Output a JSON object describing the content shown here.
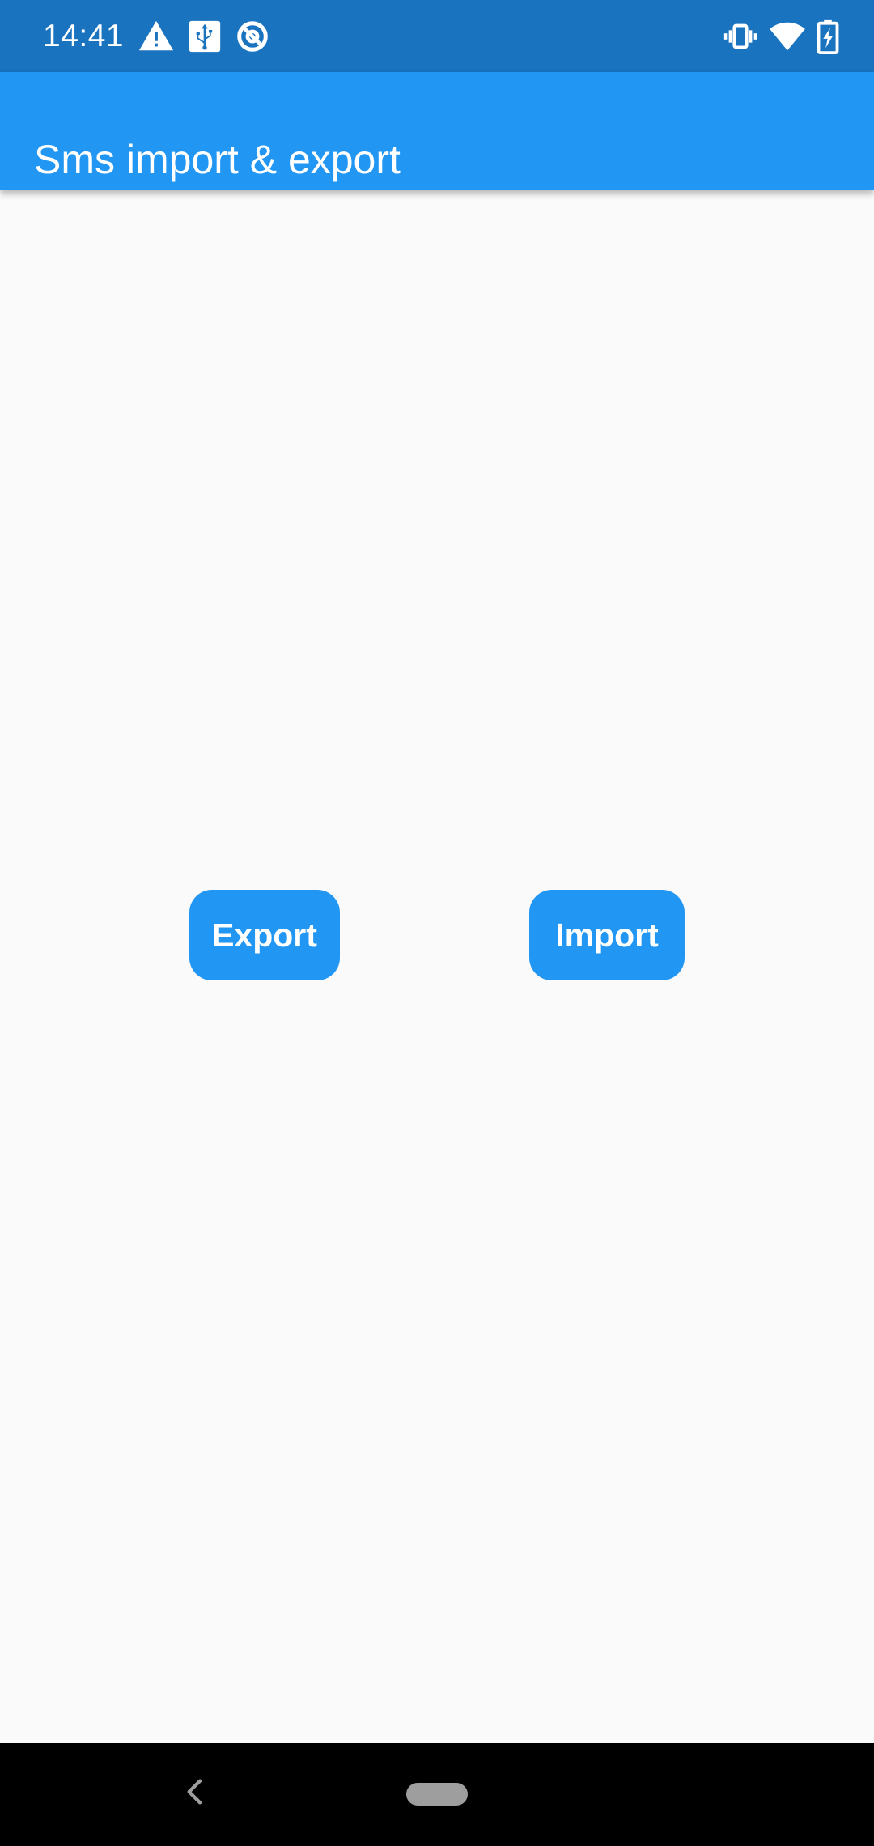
{
  "status_bar": {
    "time": "14:41",
    "icons_left": [
      "warning-icon",
      "usb-icon",
      "sync-disabled-icon"
    ],
    "icons_right": [
      "vibrate-icon",
      "wifi-icon",
      "battery-charging-icon"
    ]
  },
  "app_bar": {
    "title": "Sms import & export"
  },
  "main": {
    "export_label": "Export",
    "import_label": "Import"
  },
  "nav_bar": {
    "back": "back-icon",
    "home": "home-pill"
  },
  "colors": {
    "status_bar": "#1a73bf",
    "app_bar": "#2196f3",
    "button": "#2196f3",
    "background": "#fafafa",
    "nav_bar": "#000000"
  }
}
